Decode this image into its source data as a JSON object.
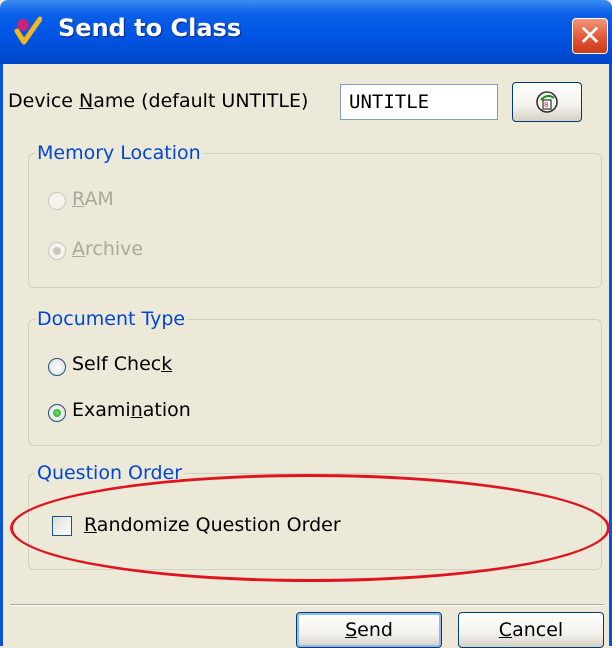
{
  "window": {
    "title": "Send to Class",
    "close_symbol": "✕"
  },
  "device": {
    "label_pre": "Device ",
    "label_key": "N",
    "label_post": "ame (default UNTITLE)",
    "value": "UNTITLE"
  },
  "memory": {
    "legend": "Memory Location",
    "ram": {
      "key": "R",
      "rest": "AM",
      "selected": false,
      "enabled": false
    },
    "archive": {
      "key": "A",
      "rest": "rchive",
      "selected": true,
      "enabled": false
    }
  },
  "doctype": {
    "legend": "Document Type",
    "selfcheck": {
      "pre": "Self Chec",
      "key": "k",
      "post": "",
      "selected": false
    },
    "exam": {
      "pre": "Exami",
      "key": "n",
      "post": "ation",
      "selected": true
    }
  },
  "order": {
    "legend": "Question Order",
    "randomize": {
      "key": "R",
      "rest": "andomize Question Order",
      "checked": false
    }
  },
  "buttons": {
    "send": {
      "key": "S",
      "rest": "end"
    },
    "cancel": {
      "key": "C",
      "rest": "ancel"
    }
  },
  "colors": {
    "titlebar": "#0055E5",
    "group_label": "#0046D5",
    "highlight_ellipse": "#E0141E",
    "dialog_bg": "#ECE9D8"
  }
}
